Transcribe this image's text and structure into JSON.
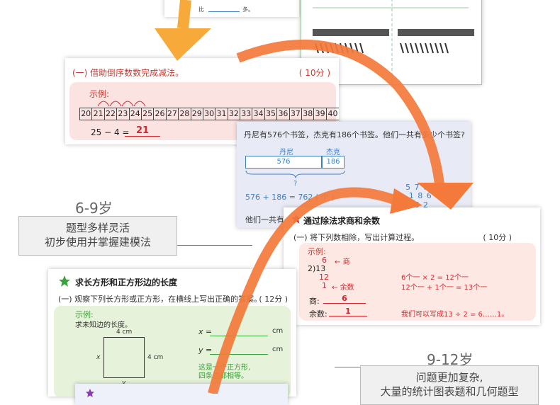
{
  "top_left_card": {
    "frac_text": "比",
    "suffix": "多。"
  },
  "card1": {
    "title": "(一) 借助倒序数数完成减法。",
    "score": "( 10分 )",
    "example_label": "示例:",
    "number_line": [
      "20",
      "21",
      "22",
      "23",
      "24",
      "25",
      "26",
      "27",
      "28",
      "29",
      "30",
      "31",
      "32",
      "33",
      "34",
      "35",
      "36",
      "37",
      "38",
      "39",
      "40"
    ],
    "equation": "25 − 4 =",
    "answer": "21"
  },
  "card2": {
    "question": "丹尼有576个书签，杰克有186个书签。他们一共有多少个书签?",
    "label_a": "丹尼",
    "label_b": "杰克",
    "value_a": "576",
    "value_b": "186",
    "unknown": "?",
    "equation": "576 + 186 = 762 ( 个 )",
    "bottom_text": "他们一共有",
    "vertical": {
      "row1": "5 7 6",
      "row2": "+ 1 8 6",
      "row3": "7 6 2"
    }
  },
  "card3": {
    "title": "通过除法求商和余数",
    "sub": "(一) 将下列数相除，写出计算过程。",
    "score": "( 10分 )",
    "example_label": "示例:",
    "div_quot": "6",
    "div_expr": "2)13",
    "div_sub": "12",
    "div_rem": "1",
    "tag_quot": "商",
    "tag_rem": "余数",
    "line1": "6个一 × 2 = 12个一",
    "line2": "12个一 + 1个一 = 13个一",
    "quot_label": "商:",
    "quot_value": "6",
    "rem_label": "余数:",
    "rem_value": "1",
    "note": "我们可以写成13 ÷ 2 = 6……1。"
  },
  "card4": {
    "title": "求长方形和正方形边的长度",
    "sub": "(一) 观察下列长方形或正方形，在横线上写出正确的答案。",
    "score": "( 12分 )",
    "example_label": "示例:",
    "example_desc": "求未知边的长度。",
    "top_len": "4 cm",
    "right_len": "4 cm",
    "x_label": "x",
    "y_label": "y",
    "x_eq": "x =",
    "y_eq": "y =",
    "unit": "cm",
    "hint1": "这是一个正方形,",
    "hint2": "四条边都相等。"
  },
  "age1": "6-9岁",
  "caption1_line1": "题型多样灵活",
  "caption1_line2": "初步使用并掌握建模法",
  "age2": "9-12岁",
  "caption2_line1": "问题更加复杂,",
  "caption2_line2": "大量的统计图表题和几何题型",
  "colors": {
    "arrow_orange": "#f37a3b",
    "arrow_yellow": "#f7a93a",
    "red": "#d8272f",
    "green_star": "#3aa23a"
  }
}
